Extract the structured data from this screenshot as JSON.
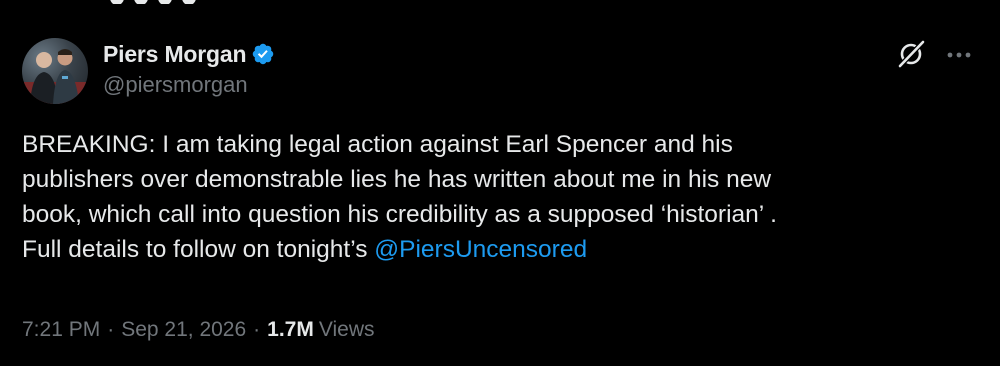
{
  "author": {
    "display_name": "Piers Morgan",
    "handle": "@piersmorgan",
    "verified": true,
    "avatar_icon": "avatar-photo"
  },
  "actions": {
    "grok_icon": "grok-icon",
    "more_icon": "more-options-icon"
  },
  "tweet": {
    "text_main": "BREAKING: I am taking legal action against Earl Spencer and his\npublishers over demonstrable lies he has written about me in his new\nbook, which call into question his credibility as a supposed ‘historian’ .\nFull details to follow on tonight’s ",
    "mention": "@PiersUncensored"
  },
  "meta": {
    "time": "7:21 PM",
    "separator": "·",
    "date": "Sep 21, 2026",
    "views_count": "1.7M",
    "views_label": "Views"
  },
  "colors": {
    "background": "#000000",
    "text": "#e7e9ea",
    "secondary": "#71767b",
    "accent": "#1d9bf0"
  }
}
